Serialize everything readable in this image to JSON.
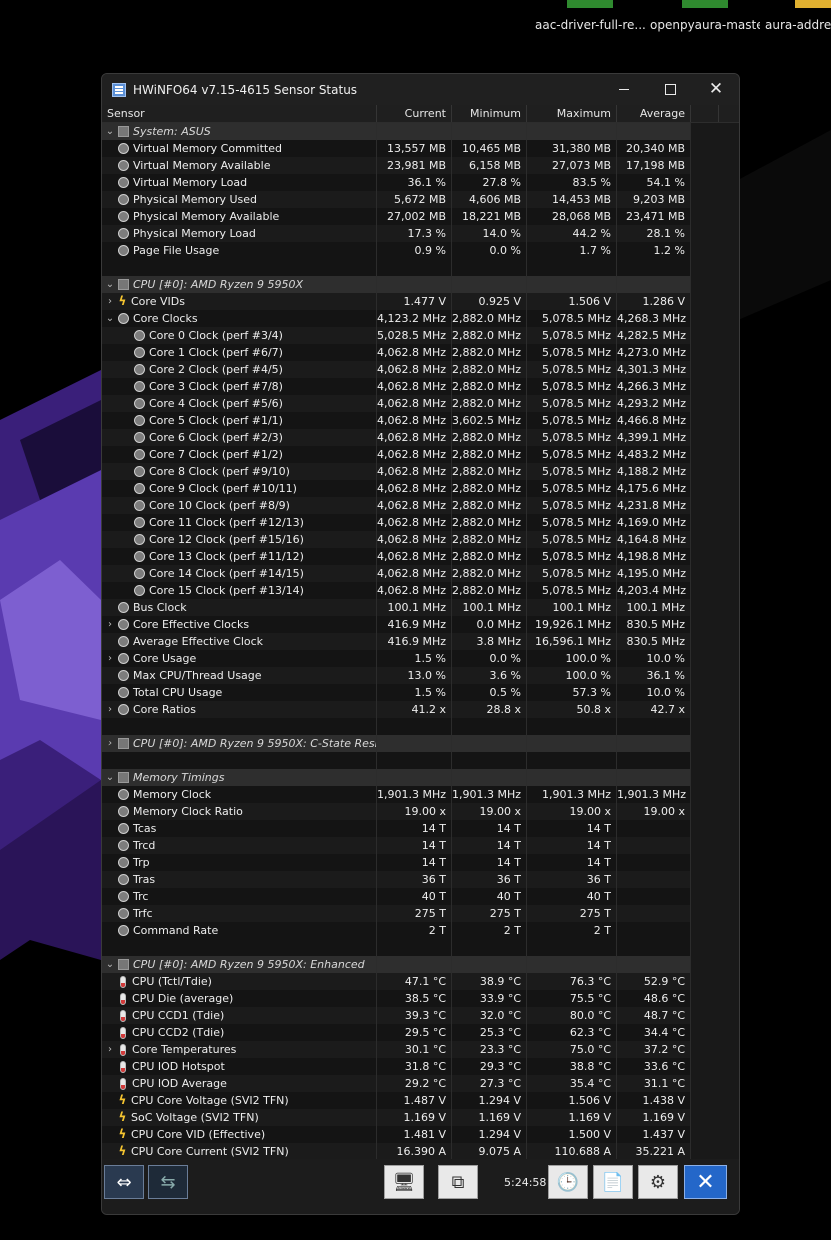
{
  "desktop": {
    "icons": [
      {
        "label": "aac-driver-full-re..."
      },
      {
        "label": "openpyaura-maste..."
      },
      {
        "label": "aura-addres"
      }
    ]
  },
  "window": {
    "title": "HWiNFO64 v7.15-4615 Sensor Status",
    "columns": [
      "Sensor",
      "Current",
      "Minimum",
      "Maximum",
      "Average"
    ]
  },
  "rows": [
    {
      "type": "group",
      "indent": 0,
      "expander": "v",
      "icon": "chip-icon",
      "label": "System: ASUS"
    },
    {
      "type": "sensor",
      "indent": 1,
      "icon": "clock-icon",
      "label": "Virtual Memory Committed",
      "cur": "13,557 MB",
      "min": "10,465 MB",
      "max": "31,380 MB",
      "avg": "20,340 MB"
    },
    {
      "type": "sensor",
      "indent": 1,
      "icon": "clock-icon",
      "label": "Virtual Memory Available",
      "cur": "23,981 MB",
      "min": "6,158 MB",
      "max": "27,073 MB",
      "avg": "17,198 MB"
    },
    {
      "type": "sensor",
      "indent": 1,
      "icon": "clock-icon",
      "label": "Virtual Memory Load",
      "cur": "36.1 %",
      "min": "27.8 %",
      "max": "83.5 %",
      "avg": "54.1 %"
    },
    {
      "type": "sensor",
      "indent": 1,
      "icon": "clock-icon",
      "label": "Physical Memory Used",
      "cur": "5,672 MB",
      "min": "4,606 MB",
      "max": "14,453 MB",
      "avg": "9,203 MB"
    },
    {
      "type": "sensor",
      "indent": 1,
      "icon": "clock-icon",
      "label": "Physical Memory Available",
      "cur": "27,002 MB",
      "min": "18,221 MB",
      "max": "28,068 MB",
      "avg": "23,471 MB"
    },
    {
      "type": "sensor",
      "indent": 1,
      "icon": "clock-icon",
      "label": "Physical Memory Load",
      "cur": "17.3 %",
      "min": "14.0 %",
      "max": "44.2 %",
      "avg": "28.1 %"
    },
    {
      "type": "sensor",
      "indent": 1,
      "icon": "clock-icon",
      "label": "Page File Usage",
      "cur": "0.9 %",
      "min": "0.0 %",
      "max": "1.7 %",
      "avg": "1.2 %"
    },
    {
      "type": "blank"
    },
    {
      "type": "group",
      "indent": 0,
      "expander": "v",
      "icon": "chip-icon",
      "label": "CPU [#0]: AMD Ryzen 9 5950X"
    },
    {
      "type": "sensor",
      "indent": 1,
      "expander": ">",
      "icon": "bolt-icon",
      "label": "Core VIDs",
      "cur": "1.477 V",
      "min": "0.925 V",
      "max": "1.506 V",
      "avg": "1.286 V"
    },
    {
      "type": "sensor",
      "indent": 1,
      "expander": "v",
      "icon": "clock-icon",
      "label": "Core Clocks",
      "cur": "4,123.2 MHz",
      "min": "2,882.0 MHz",
      "max": "5,078.5 MHz",
      "avg": "4,268.3 MHz"
    },
    {
      "type": "sensor",
      "indent": 2,
      "icon": "clock-icon",
      "label": "Core 0 Clock (perf #3/4)",
      "cur": "5,028.5 MHz",
      "min": "2,882.0 MHz",
      "max": "5,078.5 MHz",
      "avg": "4,282.5 MHz"
    },
    {
      "type": "sensor",
      "indent": 2,
      "icon": "clock-icon",
      "label": "Core 1 Clock (perf #6/7)",
      "cur": "4,062.8 MHz",
      "min": "2,882.0 MHz",
      "max": "5,078.5 MHz",
      "avg": "4,273.0 MHz"
    },
    {
      "type": "sensor",
      "indent": 2,
      "icon": "clock-icon",
      "label": "Core 2 Clock (perf #4/5)",
      "cur": "4,062.8 MHz",
      "min": "2,882.0 MHz",
      "max": "5,078.5 MHz",
      "avg": "4,301.3 MHz"
    },
    {
      "type": "sensor",
      "indent": 2,
      "icon": "clock-icon",
      "label": "Core 3 Clock (perf #7/8)",
      "cur": "4,062.8 MHz",
      "min": "2,882.0 MHz",
      "max": "5,078.5 MHz",
      "avg": "4,266.3 MHz"
    },
    {
      "type": "sensor",
      "indent": 2,
      "icon": "clock-icon",
      "label": "Core 4 Clock (perf #5/6)",
      "cur": "4,062.8 MHz",
      "min": "2,882.0 MHz",
      "max": "5,078.5 MHz",
      "avg": "4,293.2 MHz"
    },
    {
      "type": "sensor",
      "indent": 2,
      "icon": "clock-icon",
      "label": "Core 5 Clock (perf #1/1)",
      "cur": "4,062.8 MHz",
      "min": "3,602.5 MHz",
      "max": "5,078.5 MHz",
      "avg": "4,466.8 MHz"
    },
    {
      "type": "sensor",
      "indent": 2,
      "icon": "clock-icon",
      "label": "Core 6 Clock (perf #2/3)",
      "cur": "4,062.8 MHz",
      "min": "2,882.0 MHz",
      "max": "5,078.5 MHz",
      "avg": "4,399.1 MHz"
    },
    {
      "type": "sensor",
      "indent": 2,
      "icon": "clock-icon",
      "label": "Core 7 Clock (perf #1/2)",
      "cur": "4,062.8 MHz",
      "min": "2,882.0 MHz",
      "max": "5,078.5 MHz",
      "avg": "4,483.2 MHz"
    },
    {
      "type": "sensor",
      "indent": 2,
      "icon": "clock-icon",
      "label": "Core 8 Clock (perf #9/10)",
      "cur": "4,062.8 MHz",
      "min": "2,882.0 MHz",
      "max": "5,078.5 MHz",
      "avg": "4,188.2 MHz"
    },
    {
      "type": "sensor",
      "indent": 2,
      "icon": "clock-icon",
      "label": "Core 9 Clock (perf #10/11)",
      "cur": "4,062.8 MHz",
      "min": "2,882.0 MHz",
      "max": "5,078.5 MHz",
      "avg": "4,175.6 MHz"
    },
    {
      "type": "sensor",
      "indent": 2,
      "icon": "clock-icon",
      "label": "Core 10 Clock (perf #8/9)",
      "cur": "4,062.8 MHz",
      "min": "2,882.0 MHz",
      "max": "5,078.5 MHz",
      "avg": "4,231.8 MHz"
    },
    {
      "type": "sensor",
      "indent": 2,
      "icon": "clock-icon",
      "label": "Core 11 Clock (perf #12/13)",
      "cur": "4,062.8 MHz",
      "min": "2,882.0 MHz",
      "max": "5,078.5 MHz",
      "avg": "4,169.0 MHz"
    },
    {
      "type": "sensor",
      "indent": 2,
      "icon": "clock-icon",
      "label": "Core 12 Clock (perf #15/16)",
      "cur": "4,062.8 MHz",
      "min": "2,882.0 MHz",
      "max": "5,078.5 MHz",
      "avg": "4,164.8 MHz"
    },
    {
      "type": "sensor",
      "indent": 2,
      "icon": "clock-icon",
      "label": "Core 13 Clock (perf #11/12)",
      "cur": "4,062.8 MHz",
      "min": "2,882.0 MHz",
      "max": "5,078.5 MHz",
      "avg": "4,198.8 MHz"
    },
    {
      "type": "sensor",
      "indent": 2,
      "icon": "clock-icon",
      "label": "Core 14 Clock (perf #14/15)",
      "cur": "4,062.8 MHz",
      "min": "2,882.0 MHz",
      "max": "5,078.5 MHz",
      "avg": "4,195.0 MHz"
    },
    {
      "type": "sensor",
      "indent": 2,
      "icon": "clock-icon",
      "label": "Core 15 Clock (perf #13/14)",
      "cur": "4,062.8 MHz",
      "min": "2,882.0 MHz",
      "max": "5,078.5 MHz",
      "avg": "4,203.4 MHz"
    },
    {
      "type": "sensor",
      "indent": 1,
      "icon": "clock-icon",
      "label": "Bus Clock",
      "cur": "100.1 MHz",
      "min": "100.1 MHz",
      "max": "100.1 MHz",
      "avg": "100.1 MHz"
    },
    {
      "type": "sensor",
      "indent": 1,
      "expander": ">",
      "icon": "clock-icon",
      "label": "Core Effective Clocks",
      "cur": "416.9 MHz",
      "min": "0.0 MHz",
      "max": "19,926.1 MHz",
      "avg": "830.5 MHz"
    },
    {
      "type": "sensor",
      "indent": 1,
      "icon": "clock-icon",
      "label": "Average Effective Clock",
      "cur": "416.9 MHz",
      "min": "3.8 MHz",
      "max": "16,596.1 MHz",
      "avg": "830.5 MHz"
    },
    {
      "type": "sensor",
      "indent": 1,
      "expander": ">",
      "icon": "clock-icon",
      "label": "Core Usage",
      "cur": "1.5 %",
      "min": "0.0 %",
      "max": "100.0 %",
      "avg": "10.0 %"
    },
    {
      "type": "sensor",
      "indent": 1,
      "icon": "clock-icon",
      "label": "Max CPU/Thread Usage",
      "cur": "13.0 %",
      "min": "3.6 %",
      "max": "100.0 %",
      "avg": "36.1 %"
    },
    {
      "type": "sensor",
      "indent": 1,
      "icon": "clock-icon",
      "label": "Total CPU Usage",
      "cur": "1.5 %",
      "min": "0.5 %",
      "max": "57.3 %",
      "avg": "10.0 %"
    },
    {
      "type": "sensor",
      "indent": 1,
      "expander": ">",
      "icon": "clock-icon",
      "label": "Core Ratios",
      "cur": "41.2 x",
      "min": "28.8 x",
      "max": "50.8 x",
      "avg": "42.7 x"
    },
    {
      "type": "blank"
    },
    {
      "type": "group",
      "indent": 0,
      "expander": ">",
      "icon": "chip-icon",
      "label": "CPU [#0]: AMD Ryzen 9 5950X: C-State Resi..."
    },
    {
      "type": "blank"
    },
    {
      "type": "group",
      "indent": 0,
      "expander": "v",
      "icon": "chip-icon",
      "label": "Memory Timings"
    },
    {
      "type": "sensor",
      "indent": 1,
      "icon": "clock-icon",
      "label": "Memory Clock",
      "cur": "1,901.3 MHz",
      "min": "1,901.3 MHz",
      "max": "1,901.3 MHz",
      "avg": "1,901.3 MHz"
    },
    {
      "type": "sensor",
      "indent": 1,
      "icon": "clock-icon",
      "label": "Memory Clock Ratio",
      "cur": "19.00 x",
      "min": "19.00 x",
      "max": "19.00 x",
      "avg": "19.00 x"
    },
    {
      "type": "sensor",
      "indent": 1,
      "icon": "clock-icon",
      "label": "Tcas",
      "cur": "14 T",
      "min": "14 T",
      "max": "14 T",
      "avg": ""
    },
    {
      "type": "sensor",
      "indent": 1,
      "icon": "clock-icon",
      "label": "Trcd",
      "cur": "14 T",
      "min": "14 T",
      "max": "14 T",
      "avg": ""
    },
    {
      "type": "sensor",
      "indent": 1,
      "icon": "clock-icon",
      "label": "Trp",
      "cur": "14 T",
      "min": "14 T",
      "max": "14 T",
      "avg": ""
    },
    {
      "type": "sensor",
      "indent": 1,
      "icon": "clock-icon",
      "label": "Tras",
      "cur": "36 T",
      "min": "36 T",
      "max": "36 T",
      "avg": ""
    },
    {
      "type": "sensor",
      "indent": 1,
      "icon": "clock-icon",
      "label": "Trc",
      "cur": "40 T",
      "min": "40 T",
      "max": "40 T",
      "avg": ""
    },
    {
      "type": "sensor",
      "indent": 1,
      "icon": "clock-icon",
      "label": "Trfc",
      "cur": "275 T",
      "min": "275 T",
      "max": "275 T",
      "avg": ""
    },
    {
      "type": "sensor",
      "indent": 1,
      "icon": "clock-icon",
      "label": "Command Rate",
      "cur": "2 T",
      "min": "2 T",
      "max": "2 T",
      "avg": ""
    },
    {
      "type": "blank"
    },
    {
      "type": "group",
      "indent": 0,
      "expander": "v",
      "icon": "chip-icon",
      "label": "CPU [#0]: AMD Ryzen 9 5950X: Enhanced"
    },
    {
      "type": "sensor",
      "indent": 1,
      "icon": "thermometer-icon",
      "label": "CPU (Tctl/Tdie)",
      "cur": "47.1 °C",
      "min": "38.9 °C",
      "max": "76.3 °C",
      "avg": "52.9 °C"
    },
    {
      "type": "sensor",
      "indent": 1,
      "icon": "thermometer-icon",
      "label": "CPU Die (average)",
      "cur": "38.5 °C",
      "min": "33.9 °C",
      "max": "75.5 °C",
      "avg": "48.6 °C"
    },
    {
      "type": "sensor",
      "indent": 1,
      "icon": "thermometer-icon",
      "label": "CPU CCD1 (Tdie)",
      "cur": "39.3 °C",
      "min": "32.0 °C",
      "max": "80.0 °C",
      "avg": "48.7 °C"
    },
    {
      "type": "sensor",
      "indent": 1,
      "icon": "thermometer-icon",
      "label": "CPU CCD2 (Tdie)",
      "cur": "29.5 °C",
      "min": "25.3 °C",
      "max": "62.3 °C",
      "avg": "34.4 °C"
    },
    {
      "type": "sensor",
      "indent": 1,
      "expander": ">",
      "icon": "thermometer-icon",
      "label": "Core Temperatures",
      "cur": "30.1 °C",
      "min": "23.3 °C",
      "max": "75.0 °C",
      "avg": "37.2 °C"
    },
    {
      "type": "sensor",
      "indent": 1,
      "icon": "thermometer-icon",
      "label": "CPU IOD Hotspot",
      "cur": "31.8 °C",
      "min": "29.3 °C",
      "max": "38.8 °C",
      "avg": "33.6 °C"
    },
    {
      "type": "sensor",
      "indent": 1,
      "icon": "thermometer-icon",
      "label": "CPU IOD Average",
      "cur": "29.2 °C",
      "min": "27.3 °C",
      "max": "35.4 °C",
      "avg": "31.1 °C"
    },
    {
      "type": "sensor",
      "indent": 1,
      "icon": "bolt-icon",
      "label": "CPU Core Voltage (SVI2 TFN)",
      "cur": "1.487 V",
      "min": "1.294 V",
      "max": "1.506 V",
      "avg": "1.438 V"
    },
    {
      "type": "sensor",
      "indent": 1,
      "icon": "bolt-icon",
      "label": "SoC Voltage (SVI2 TFN)",
      "cur": "1.169 V",
      "min": "1.169 V",
      "max": "1.169 V",
      "avg": "1.169 V"
    },
    {
      "type": "sensor",
      "indent": 1,
      "icon": "bolt-icon",
      "label": "CPU Core VID (Effective)",
      "cur": "1.481 V",
      "min": "1.294 V",
      "max": "1.500 V",
      "avg": "1.437 V"
    },
    {
      "type": "sensor",
      "indent": 1,
      "icon": "bolt-icon",
      "label": "CPU Core Current (SVI2 TFN)",
      "cur": "16.390 A",
      "min": "9.075 A",
      "max": "110.688 A",
      "avg": "35.221 A"
    }
  ],
  "toolbar": {
    "time": "5:24:58"
  }
}
